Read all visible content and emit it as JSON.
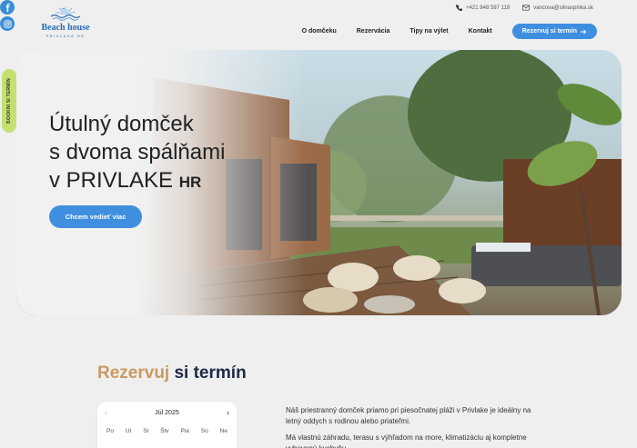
{
  "brand": {
    "name": "Beach house",
    "sub": "PRIVLAKA HR",
    "colors": {
      "primary": "#3f8fe0",
      "accent": "#c99a62",
      "navy": "#1f2a44",
      "lime": "#c5e070"
    }
  },
  "social": [
    {
      "icon": "facebook-icon"
    },
    {
      "icon": "instagram-icon"
    }
  ],
  "side_tab": {
    "label": "BOOKNI SI TERMÍN"
  },
  "contact": {
    "phone": "+421 948 597 119",
    "email": "vancova@silnaspinka.sk"
  },
  "nav": {
    "items": [
      "O domčeku",
      "Rezervácia",
      "Tipy na výlet",
      "Kontakt"
    ],
    "cta": "Rezervuj si termín"
  },
  "hero": {
    "line1": "Útulný domček",
    "line2": "s dvoma spálňami",
    "line3": "v PRIVLAKE",
    "line3_suffix": "HR",
    "button": "Chcem vedieť viac"
  },
  "section": {
    "title_accent": "Rezervuj",
    "title_rest": " si termín"
  },
  "calendar": {
    "month": "Júl",
    "year": "2025",
    "weekdays": [
      "Po",
      "Ut",
      "St",
      "Štv",
      "Pia",
      "So",
      "Ne"
    ]
  },
  "description": {
    "p1": "Náš priestranný domček priamo pri piesočnatej pláži v Privlake je ideálny na letný oddych s rodinou alebo priateľmi.",
    "p2": "Má vlastnú záhradu, terasu s výhľadom na more, klimatizáciu aj kompletne vybavenú kuchyňu."
  }
}
